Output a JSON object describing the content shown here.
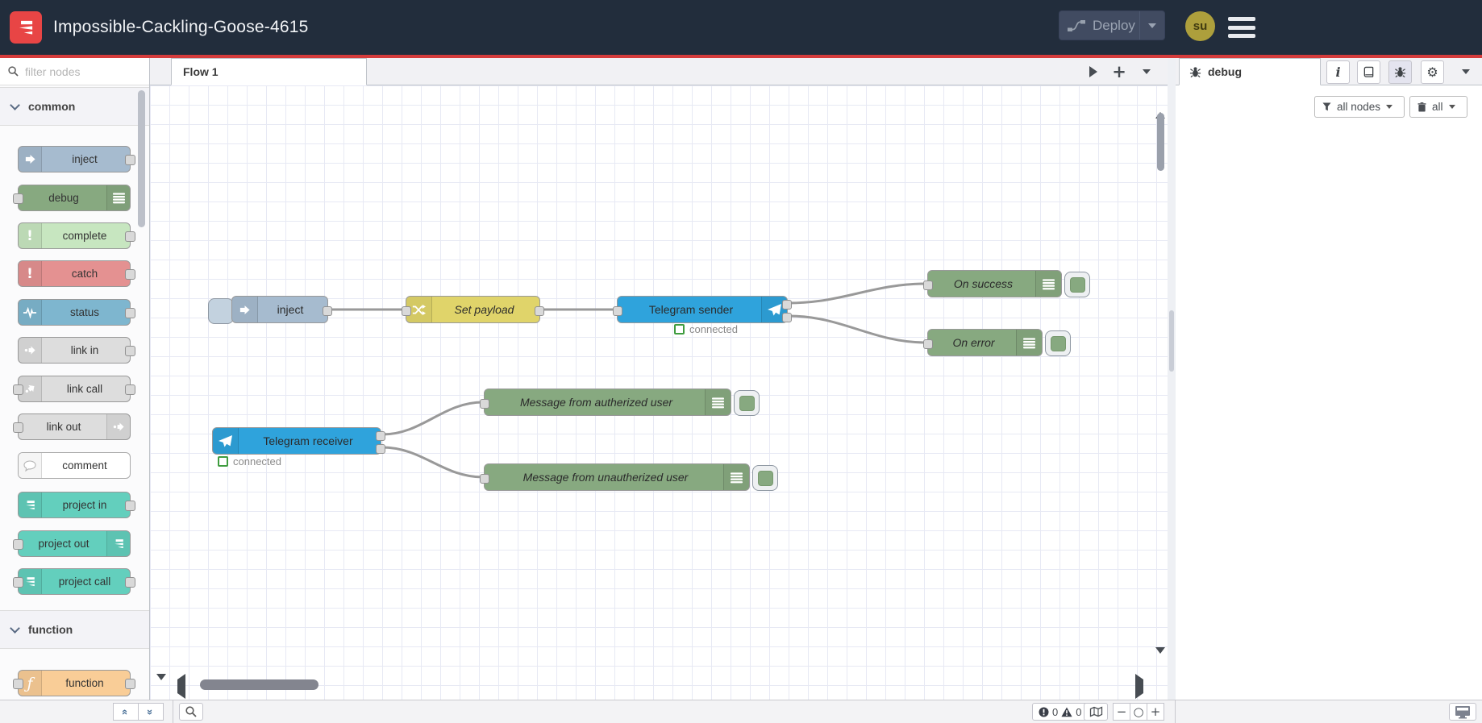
{
  "colors": {
    "header_bg": "#222d3c",
    "accent_red": "#d53b3b",
    "node_inject": "#a6bbcf",
    "node_debug": "#87a980",
    "node_complete": "#c7e6c0",
    "node_catch": "#e49191",
    "node_status": "#7eb6cf",
    "node_link": "#dddddd",
    "node_comment": "#ffffff",
    "node_project": "#63cfbd",
    "node_function": "#f9cd97",
    "node_change": "#e0d46a",
    "node_telegram": "#2fa3dc",
    "status_connected_green": "#3f9c3f",
    "avatar_bg": "#ad9f3c"
  },
  "header": {
    "title": "Impossible-Cackling-Goose-4615",
    "deploy": "Deploy",
    "avatar": "su"
  },
  "palette": {
    "search_placeholder": "filter nodes",
    "categories": [
      {
        "label": "common",
        "items": [
          {
            "label": "inject"
          },
          {
            "label": "debug"
          },
          {
            "label": "complete"
          },
          {
            "label": "catch"
          },
          {
            "label": "status"
          },
          {
            "label": "link in"
          },
          {
            "label": "link call"
          },
          {
            "label": "link out"
          },
          {
            "label": "comment"
          },
          {
            "label": "project in"
          },
          {
            "label": "project out"
          },
          {
            "label": "project call"
          }
        ]
      },
      {
        "label": "function",
        "items": [
          {
            "label": "function"
          }
        ]
      }
    ]
  },
  "canvas": {
    "tab": "Flow 1",
    "add_flow": "+",
    "nodes": {
      "inject": {
        "label": "inject"
      },
      "set_payload": {
        "label": "Set payload"
      },
      "telegram_sender": {
        "label": "Telegram sender",
        "status": "connected"
      },
      "on_success": {
        "label": "On success"
      },
      "on_error": {
        "label": "On error"
      },
      "telegram_receiver": {
        "label": "Telegram receiver",
        "status": "connected"
      },
      "msg_authorized": {
        "label": "Message from autherized user"
      },
      "msg_unauthorized": {
        "label": "Message from unautherized user"
      }
    }
  },
  "debug_panel": {
    "tab": "debug",
    "filter": "all nodes",
    "clear": "all"
  },
  "footer": {
    "collapse_all": "«",
    "expand_all": "»",
    "error_count": "0",
    "warning_count": "0",
    "zoom_out": "−",
    "zoom_reset": "○",
    "zoom_in": "+"
  }
}
